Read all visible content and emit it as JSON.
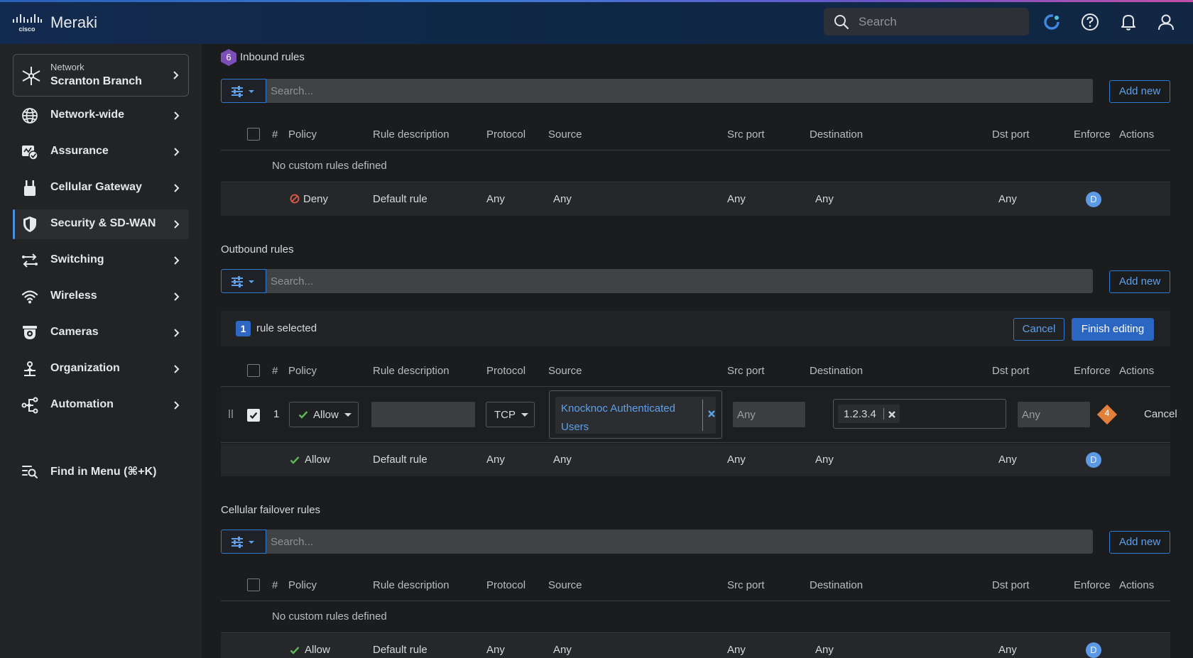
{
  "app": {
    "brand": "Meraki",
    "logo_text": "cisco",
    "search_placeholder": "Search"
  },
  "sidebar": {
    "network_label": "Network",
    "network_name": "Scranton Branch",
    "items": [
      {
        "label": "Network-wide",
        "icon": "globe-icon"
      },
      {
        "label": "Assurance",
        "icon": "assurance-icon"
      },
      {
        "label": "Cellular Gateway",
        "icon": "cellular-gateway-icon"
      },
      {
        "label": "Security & SD-WAN",
        "icon": "shield-icon",
        "active": true
      },
      {
        "label": "Switching",
        "icon": "switching-icon"
      },
      {
        "label": "Wireless",
        "icon": "wifi-icon"
      },
      {
        "label": "Cameras",
        "icon": "camera-icon"
      },
      {
        "label": "Organization",
        "icon": "organization-icon"
      },
      {
        "label": "Automation",
        "icon": "automation-icon"
      }
    ],
    "find_in_menu": "Find in Menu (⌘+K)"
  },
  "columns": {
    "num": "#",
    "policy": "Policy",
    "description": "Rule description",
    "protocol": "Protocol",
    "source": "Source",
    "src_port": "Src port",
    "destination": "Destination",
    "dst_port": "Dst port",
    "enforce": "Enforce",
    "actions": "Actions"
  },
  "common": {
    "search_placeholder": "Search...",
    "add_new": "Add new",
    "no_rules": "No custom rules defined"
  },
  "inbound": {
    "badge": "6",
    "title": "Inbound rules",
    "default_row": {
      "policy": "Deny",
      "description": "Default rule",
      "protocol": "Any",
      "source": "Any",
      "src_port": "Any",
      "destination": "Any",
      "dst_port": "Any",
      "enforce": "D"
    }
  },
  "outbound": {
    "title": "Outbound rules",
    "selected_count": "1",
    "selected_text": "rule selected",
    "cancel": "Cancel",
    "finish": "Finish editing",
    "edit_row": {
      "num": "1",
      "policy": "Allow",
      "description": "",
      "protocol": "TCP",
      "source": "Knocknoc Authenticated Users",
      "src_port": "Any",
      "destination": "1.2.3.4",
      "dst_port": "Any",
      "enforce": "4",
      "action": "Cancel"
    },
    "default_row": {
      "policy": "Allow",
      "description": "Default rule",
      "protocol": "Any",
      "source": "Any",
      "src_port": "Any",
      "destination": "Any",
      "dst_port": "Any",
      "enforce": "D"
    }
  },
  "cellular": {
    "title": "Cellular failover rules",
    "default_row": {
      "policy": "Allow",
      "description": "Default rule",
      "protocol": "Any",
      "source": "Any",
      "src_port": "Any",
      "destination": "Any",
      "dst_port": "Any",
      "enforce": "D"
    }
  }
}
